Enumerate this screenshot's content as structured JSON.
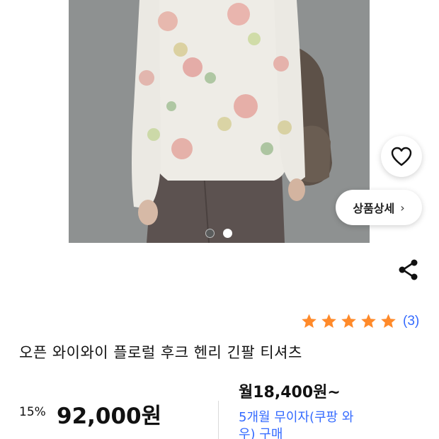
{
  "product_image": {
    "alt": "",
    "dots": [
      {
        "state": "inactive"
      },
      {
        "state": "active"
      }
    ]
  },
  "actions": {
    "wishlist_icon": "heart-outline-icon",
    "detail_button_label": "상품상세",
    "detail_button_chevron": "›",
    "share_icon": "share-icon"
  },
  "rating": {
    "stars": 5,
    "star_color": "#ff8a2a",
    "review_count": "(3)"
  },
  "product": {
    "title": "오픈 와이와이 플로럴 후크 헨리 긴팔 티셔츠",
    "discount_rate": "15%",
    "price": "92,000원",
    "monthly_price": "월18,400원~",
    "installment_text": "5개월 무이자(쿠팡 와우) 구매"
  },
  "colors": {
    "link_blue": "#346aff"
  }
}
